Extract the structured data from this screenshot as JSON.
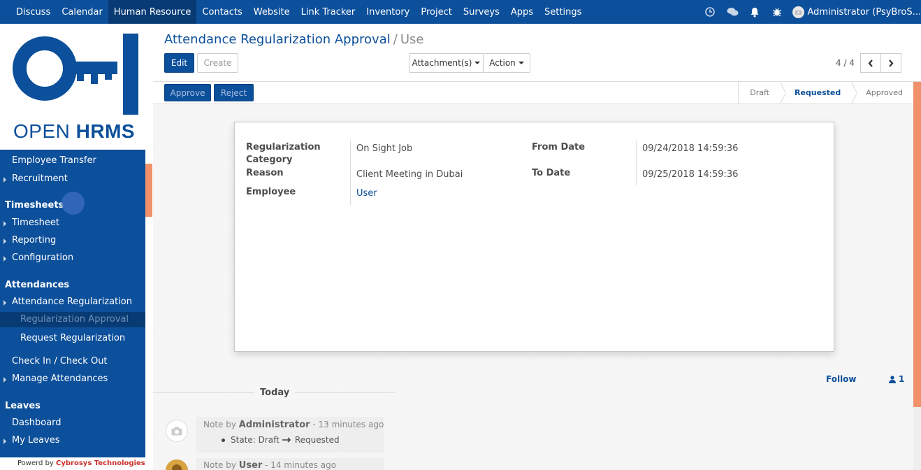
{
  "topbar": {
    "menu": [
      "Discuss",
      "Calendar",
      "Human Resource",
      "Contacts",
      "Website",
      "Link Tracker",
      "Inventory",
      "Project",
      "Surveys",
      "Apps",
      "Settings"
    ],
    "active": "Human Resource",
    "icons": [
      "clock-icon",
      "chat-icon",
      "bell-icon",
      "bug-icon"
    ],
    "user": "Administrator (PsyBroS..."
  },
  "logo": {
    "brand_light": "OPEN ",
    "brand_bold": "HRMS"
  },
  "sidebar": {
    "items": [
      {
        "label": "Employee Transfer",
        "kind": "lvl1",
        "caret": false
      },
      {
        "label": "Recruitment",
        "kind": "lvl1",
        "caret": true
      },
      {
        "label": "Timesheets",
        "kind": "head",
        "caret": false
      },
      {
        "label": "Timesheet",
        "kind": "lvl1",
        "caret": true
      },
      {
        "label": "Reporting",
        "kind": "lvl1",
        "caret": true
      },
      {
        "label": "Configuration",
        "kind": "lvl1",
        "caret": true
      },
      {
        "label": "Attendances",
        "kind": "head",
        "caret": false
      },
      {
        "label": "Attendance Regularization",
        "kind": "lvl1",
        "caret": true
      },
      {
        "label": "Regularization Approval",
        "kind": "lvl2",
        "caret": false,
        "selected": true
      },
      {
        "label": "Request Regularization",
        "kind": "lvl2",
        "caret": false
      },
      {
        "label": "Check In / Check Out",
        "kind": "lvl1",
        "caret": false
      },
      {
        "label": "Manage Attendances",
        "kind": "lvl1",
        "caret": true
      },
      {
        "label": "Leaves",
        "kind": "head",
        "caret": false
      },
      {
        "label": "Dashboard",
        "kind": "lvl1",
        "caret": false
      },
      {
        "label": "My Leaves",
        "kind": "lvl1",
        "caret": true
      }
    ],
    "powered_prefix": "Powerd by ",
    "powered_company": "Cybrosys Technologies"
  },
  "control": {
    "breadcrumb_link": "Attendance Regularization Approval",
    "breadcrumb_sep": "/",
    "breadcrumb_current": "Use",
    "edit": "Edit",
    "create": "Create",
    "attachments": "Attachment(s)",
    "action": "Action",
    "pager": "4 / 4"
  },
  "status": {
    "approve": "Approve",
    "reject": "Reject",
    "stages": [
      "Draft",
      "Requested",
      "Approved"
    ],
    "current_stage": "Requested"
  },
  "form": {
    "category_label": "Regularization Category",
    "category_value": "On Sight Job",
    "reason_label": "Reason",
    "reason_value": "Client Meeting in Dubai",
    "employee_label": "Employee",
    "employee_value": "User",
    "from_label": "From Date",
    "from_value": "09/24/2018 14:59:36",
    "to_label": "To Date",
    "to_value": "09/25/2018 14:59:36"
  },
  "chatter": {
    "follow": "Follow",
    "followers": "1",
    "today": "Today",
    "messages": [
      {
        "prefix": "Note by ",
        "author": "Administrator",
        "time": " - 13 minutes ago",
        "body": "State: Draft",
        "body_to": "Requested"
      },
      {
        "prefix": "Note by ",
        "author": "User",
        "time": " - 14 minutes ago"
      }
    ]
  },
  "colors": {
    "brand": "#0c4f9a",
    "brand_dark": "#083b74",
    "accent": "#f0916a"
  }
}
